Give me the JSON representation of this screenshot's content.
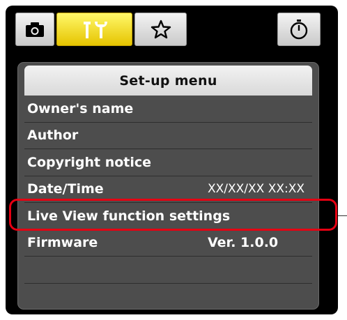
{
  "tabs": [
    {
      "icon": "camera-icon",
      "active": false
    },
    {
      "icon": "wrench-tools-icon",
      "active": true
    },
    {
      "icon": "star-icon",
      "active": false
    },
    {
      "icon": "stopwatch-icon",
      "active": false
    }
  ],
  "menu": {
    "title": "Set-up menu",
    "items": [
      {
        "label": "Owner's name",
        "value": ""
      },
      {
        "label": "Author",
        "value": ""
      },
      {
        "label": "Copyright notice",
        "value": ""
      },
      {
        "label": "Date/Time",
        "value": "XX/XX/XX XX:XX"
      },
      {
        "label": "Live View function settings",
        "value": ""
      },
      {
        "label": "Firmware",
        "value": "Ver. 1.0.0"
      }
    ]
  },
  "colors": {
    "active_tab": "#f0d800",
    "highlight": "#e60012",
    "panel": "#4d4d4d"
  }
}
